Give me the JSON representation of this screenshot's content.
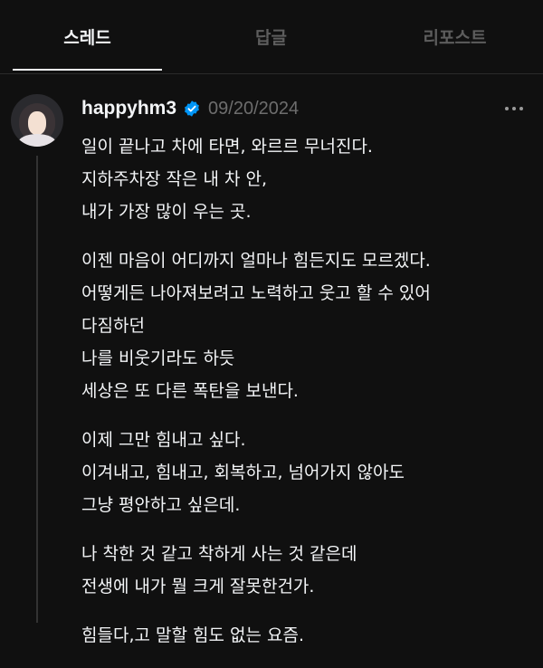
{
  "tabs": [
    {
      "label": "스레드",
      "active": true
    },
    {
      "label": "답글",
      "active": false
    },
    {
      "label": "리포스트",
      "active": false
    }
  ],
  "post": {
    "username": "happyhm3",
    "verified": true,
    "date": "09/20/2024",
    "paragraphs": [
      [
        "일이 끝나고 차에 타면, 와르르 무너진다.",
        "지하주차장 작은 내 차 안,",
        "내가 가장 많이 우는 곳."
      ],
      [
        "이젠 마음이 어디까지 얼마나 힘든지도 모르겠다.",
        "어떻게든 나아져보려고 노력하고 웃고 할 수 있어",
        "다짐하던",
        "나를 비웃기라도 하듯",
        "세상은 또 다른 폭탄을 보낸다."
      ],
      [
        "이제 그만 힘내고 싶다.",
        "이겨내고, 힘내고, 회복하고, 넘어가지 않아도",
        "그냥 평안하고 싶은데."
      ],
      [
        "나 착한 것 같고 착하게 사는 것 같은데",
        "전생에 내가 뭘 크게 잘못한건가."
      ],
      [
        "힘들다,고 말할 힘도 없는 요즘."
      ]
    ]
  },
  "icons": {
    "verified": "verified-badge-icon",
    "more": "more-horizontal-icon"
  },
  "colors": {
    "background": "#101010",
    "text": "#f3f5f7",
    "muted": "#6d6d6d",
    "verified": "#0095f6"
  }
}
